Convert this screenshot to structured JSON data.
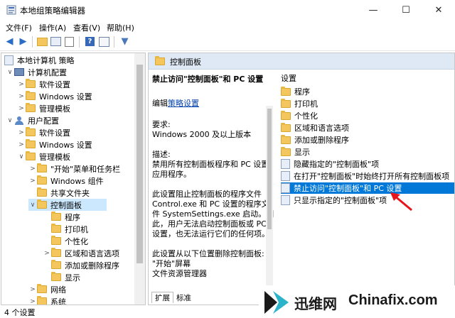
{
  "window": {
    "title": "本地组策略编辑器",
    "controls": {
      "minimize": "—",
      "maximize": "☐",
      "close": "✕"
    }
  },
  "menu": [
    "文件(F)",
    "操作(A)",
    "查看(V)",
    "帮助(H)"
  ],
  "tree": {
    "root": "本地计算机 策略",
    "computer_config": "计算机配置",
    "software_settings_1": "软件设置",
    "windows_settings_1": "Windows 设置",
    "admin_templates_1": "管理模板",
    "user_config": "用户配置",
    "software_settings_2": "软件设置",
    "windows_settings_2": "Windows 设置",
    "admin_templates_2": "管理模板",
    "start_menu": "\"开始\"菜单和任务栏",
    "windows_components": "Windows 组件",
    "shared_folders": "共享文件夹",
    "control_panel": "控制面板",
    "programs": "程序",
    "printers": "打印机",
    "personalization": "个性化",
    "region_language": "区域和语言选项",
    "add_remove_programs": "添加或删除程序",
    "display": "显示",
    "network": "网络",
    "system": "系统"
  },
  "right": {
    "header": "控制面板",
    "policy_title": "禁止访问\"控制面板\"和 PC 设置",
    "edit_prefix": "编辑",
    "edit_link": "策略设置",
    "requirements_label": "要求:",
    "requirements_value": "Windows 2000 及以上版本",
    "description_label": "描述:",
    "desc_lines": [
      "禁用所有控制面板程序和 PC 设置",
      "应用程序。",
      "",
      "此设置阻止控制面板的程序文件",
      "Control.exe 和 PC 设置的程序文",
      "件 SystemSettings.exe 启动。因",
      "此，用户无法启动控制面板或 PC",
      "设置，也无法运行它们的任何项。",
      "",
      "此设置从以下位置删除控制面板:",
      "\"开始\"屏幕",
      "文件资源管理器"
    ],
    "list_header": "设置",
    "folders": [
      "程序",
      "打印机",
      "个性化",
      "区域和语言选项",
      "添加或删除程序",
      "显示"
    ],
    "policies": [
      "隐藏指定的\"控制面板\"项",
      "在打开\"控制面板\"时始终打开所有控制面板项",
      "禁止访问\"控制面板\"和 PC 设置",
      "只显示指定的\"控制面板\"项"
    ],
    "tabs": [
      "扩展",
      "标准"
    ]
  },
  "status": "4 个设置",
  "watermark": {
    "brand": "迅维网",
    "site": "Chinafix.com"
  }
}
